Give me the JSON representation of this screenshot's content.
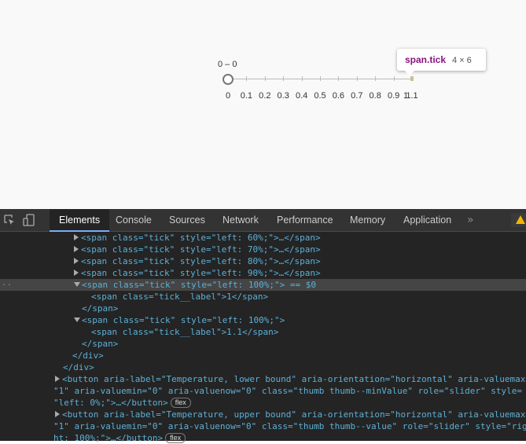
{
  "slider": {
    "range_label": "0 – 0",
    "ticks": [
      "0",
      "0.1",
      "0.2",
      "0.3",
      "0.4",
      "0.5",
      "0.6",
      "0.7",
      "0.8",
      "0.9",
      "1",
      "1.1"
    ],
    "min_value": 0,
    "max_value": 1.1,
    "lower_value": 0,
    "upper_value": 0
  },
  "tooltip": {
    "selector": "span.tick",
    "dimensions": "4 × 6"
  },
  "devtools": {
    "tabs": [
      "Elements",
      "Console",
      "Sources",
      "Network",
      "Performance",
      "Memory",
      "Application"
    ],
    "active_tab": "Elements",
    "more": "»",
    "lines": [
      "<span class=\"tick\" style=\"left: 60%;\">…</span>",
      "<span class=\"tick\" style=\"left: 70%;\">…</span>",
      "<span class=\"tick\" style=\"left: 80%;\">…</span>",
      "<span class=\"tick\" style=\"left: 90%;\">…</span>",
      "<span class=\"tick\" style=\"left: 100%;\"> == $0",
      "<span class=\"tick__label\">1</span>",
      "</span>",
      "<span class=\"tick\" style=\"left: 100%;\">",
      "<span class=\"tick__label\">1.1</span>",
      "</span>",
      "</div>",
      "</div>",
      "<button aria-label=\"Temperature, lower bound\" aria-orientation=\"horizontal\" aria-valuemax=",
      "\"1\" aria-valuemin=\"0\" aria-valuenow=\"0\" class=\"thumb thumb--minValue\" role=\"slider\" style=",
      "\"left: 0%;\">…</button>",
      "<button aria-label=\"Temperature, upper bound\" aria-orientation=\"horizontal\" aria-valuemax=",
      "\"1\" aria-valuemin=\"0\" aria-valuenow=\"0\" class=\"thumb thumb--value\" role=\"slider\" style=\"rig",
      "ht: 100%;\">…</button>"
    ],
    "badge": "flex",
    "dots": "··"
  }
}
